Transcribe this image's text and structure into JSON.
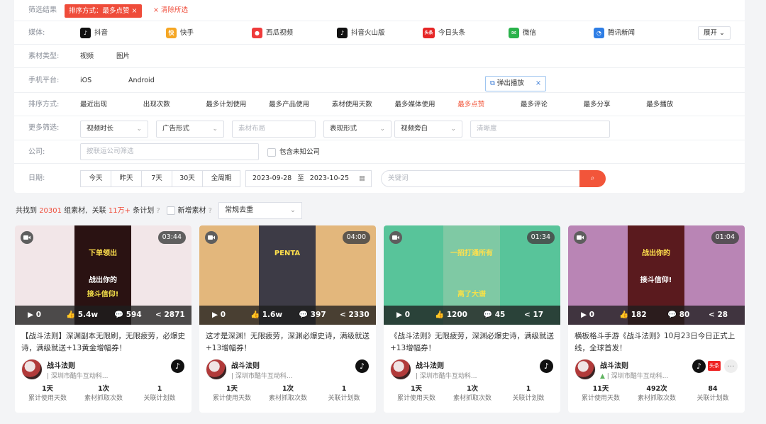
{
  "filter": {
    "result_label": "筛选结果",
    "active_tag": "排序方式：最多点赞",
    "clear": "清除所选",
    "media_label": "媒体:",
    "media": [
      {
        "name": "抖音",
        "icon": "douyin-icon",
        "color": "#111111",
        "glyph": "♪"
      },
      {
        "name": "快手",
        "icon": "kuaishou-icon",
        "color": "#f5a623",
        "glyph": "快"
      },
      {
        "name": "西瓜视频",
        "icon": "xigua-icon",
        "color": "#ef3b3b",
        "glyph": "●"
      },
      {
        "name": "抖音火山版",
        "icon": "huoshan-icon",
        "color": "#111111",
        "glyph": "♪"
      },
      {
        "name": "今日头条",
        "icon": "toutiao-icon",
        "color": "#e62727",
        "glyph": "头条"
      },
      {
        "name": "微信",
        "icon": "wechat-icon",
        "color": "#2ab24b",
        "glyph": "✉"
      },
      {
        "name": "腾讯新闻",
        "icon": "tencent-news-icon",
        "color": "#2f7ee5",
        "glyph": "◔"
      }
    ],
    "expand": "展开",
    "material_label": "素材类型:",
    "material": [
      "视频",
      "图片"
    ],
    "platform_label": "手机平台:",
    "platform": [
      "iOS",
      "Android"
    ],
    "popup": "弹出播放",
    "sort_label": "排序方式:",
    "sort": [
      "最近出现",
      "出现次数",
      "最多计划使用",
      "最多产品使用",
      "素材使用天数",
      "最多媒体使用",
      "最多点赞",
      "最多评论",
      "最多分享",
      "最多播放"
    ],
    "sort_active": "最多点赞",
    "more_label": "更多筛选:",
    "more": [
      "视频时长",
      "广告形式",
      "素材布局",
      "表现形式",
      "视频旁白",
      "清晰度"
    ],
    "company_label": "公司:",
    "company_placeholder": "按联运公司筛选",
    "include_unknown": "包含未知公司",
    "date_label": "日期:",
    "date_btns": [
      "今天",
      "昨天",
      "7天",
      "30天",
      "全周期"
    ],
    "date_from": "2023-09-28",
    "date_to_sep": "至",
    "date_to": "2023-10-25",
    "keyword_placeholder": "关键词"
  },
  "summary": {
    "found_prefix": "共找到",
    "found_count": "20301",
    "found_unit": "组素材,",
    "related_prefix": "关联",
    "related_count": "11万+",
    "related_unit": "条计划",
    "new_material": "新增素材",
    "dedup": "常规去重"
  },
  "cards": [
    {
      "duration": "03:44",
      "plays": "0",
      "likes": "5.4w",
      "comments": "594",
      "shares": "2871",
      "title": "【战斗法则】深渊副本无限刷，无限疲劳，必爆史诗，满级就送+13黄金增幅券！",
      "author": "战斗法则",
      "company": "| 深圳市酷牛互动科...",
      "os": "ios",
      "media": [
        "douyin"
      ],
      "metrics": [
        {
          "v": "1天",
          "k": "累计使用天数"
        },
        {
          "v": "1次",
          "k": "素材抓取次数"
        },
        {
          "v": "1",
          "k": "关联计划数"
        }
      ],
      "bg": "#f2e6e8",
      "vbg": "#2a1212",
      "vtext": [
        "下单领出",
        "战出你的",
        "接斗信仰!"
      ]
    },
    {
      "duration": "04:00",
      "plays": "0",
      "likes": "1.6w",
      "comments": "397",
      "shares": "2330",
      "title": "这才是深渊！无限疲劳，深渊必爆史诗，满级就送+13增幅券！",
      "author": "战斗法则",
      "company": "| 深圳市酷牛互动科...",
      "os": "ios",
      "media": [
        "douyin"
      ],
      "metrics": [
        {
          "v": "1天",
          "k": "累计使用天数"
        },
        {
          "v": "1次",
          "k": "素材抓取次数"
        },
        {
          "v": "1",
          "k": "关联计划数"
        }
      ],
      "bg": "#e3b77c",
      "vbg": "#3d3b46",
      "vtext": [
        "PENTA",
        "",
        ""
      ]
    },
    {
      "duration": "01:34",
      "plays": "0",
      "likes": "1200",
      "comments": "45",
      "shares": "17",
      "title": "《战斗法则》无限疲劳，深渊必爆史诗，满级就送+13增幅券！",
      "author": "战斗法则",
      "company": "| 深圳市酷牛互动科...",
      "os": "ios",
      "media": [
        "douyin"
      ],
      "metrics": [
        {
          "v": "1天",
          "k": "累计使用天数"
        },
        {
          "v": "1次",
          "k": "素材抓取次数"
        },
        {
          "v": "1",
          "k": "关联计划数"
        }
      ],
      "bg": "#58c49a",
      "vbg": "#7fc9a4",
      "vtext": [
        "一招打通所有",
        "",
        "离了大谱"
      ]
    },
    {
      "duration": "01:04",
      "plays": "0",
      "likes": "182",
      "comments": "80",
      "shares": "28",
      "title": "横板格斗手游《战斗法则》10月23日今日正式上线，全球首发！",
      "author": "战斗法则",
      "company": "| 深圳市酷牛互动科...",
      "os": "android",
      "media": [
        "douyin",
        "toutiao",
        "more"
      ],
      "metrics": [
        {
          "v": "11天",
          "k": "累计使用天数"
        },
        {
          "v": "492次",
          "k": "素材抓取次数"
        },
        {
          "v": "84",
          "k": "关联计划数"
        }
      ],
      "bg": "#b985b5",
      "vbg": "#5a1a1e",
      "vtext": [
        "战出你的",
        "接斗信仰!",
        ""
      ]
    }
  ]
}
